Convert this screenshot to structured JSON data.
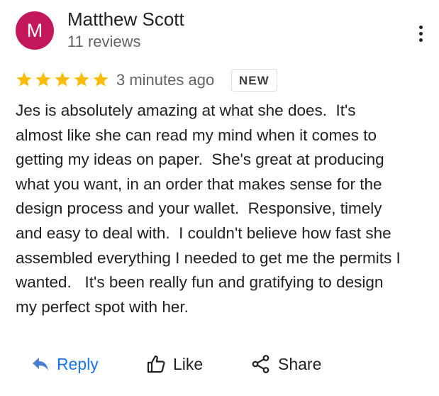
{
  "review": {
    "author": {
      "initial": "M",
      "name": "Matthew Scott",
      "review_count": "11 reviews",
      "avatar_color": "#c2185b"
    },
    "menu_icon": "more-vert-icon",
    "rating": 5,
    "star_color": "#fbbc04",
    "time_ago": "3 minutes ago",
    "badge": "NEW",
    "text": "Jes is absolutely amazing at what she does.  It's\nalmost like she can read my mind when it comes to\ngetting my ideas on paper.  She's great at producing\nwhat you want, in an order that makes sense for the\ndesign process and your wallet.  Responsive, timely\nand easy to deal with.  I couldn't believe how fast she\nassembled everything I needed to get me the permits I\nwanted.   It's been really fun and gratifying to design\nmy perfect spot with her."
  },
  "actions": {
    "reply": {
      "label": "Reply",
      "icon": "reply-arrow-icon",
      "color": "#1a73e8"
    },
    "like": {
      "label": "Like",
      "icon": "thumbs-up-icon"
    },
    "share": {
      "label": "Share",
      "icon": "share-icon"
    }
  }
}
